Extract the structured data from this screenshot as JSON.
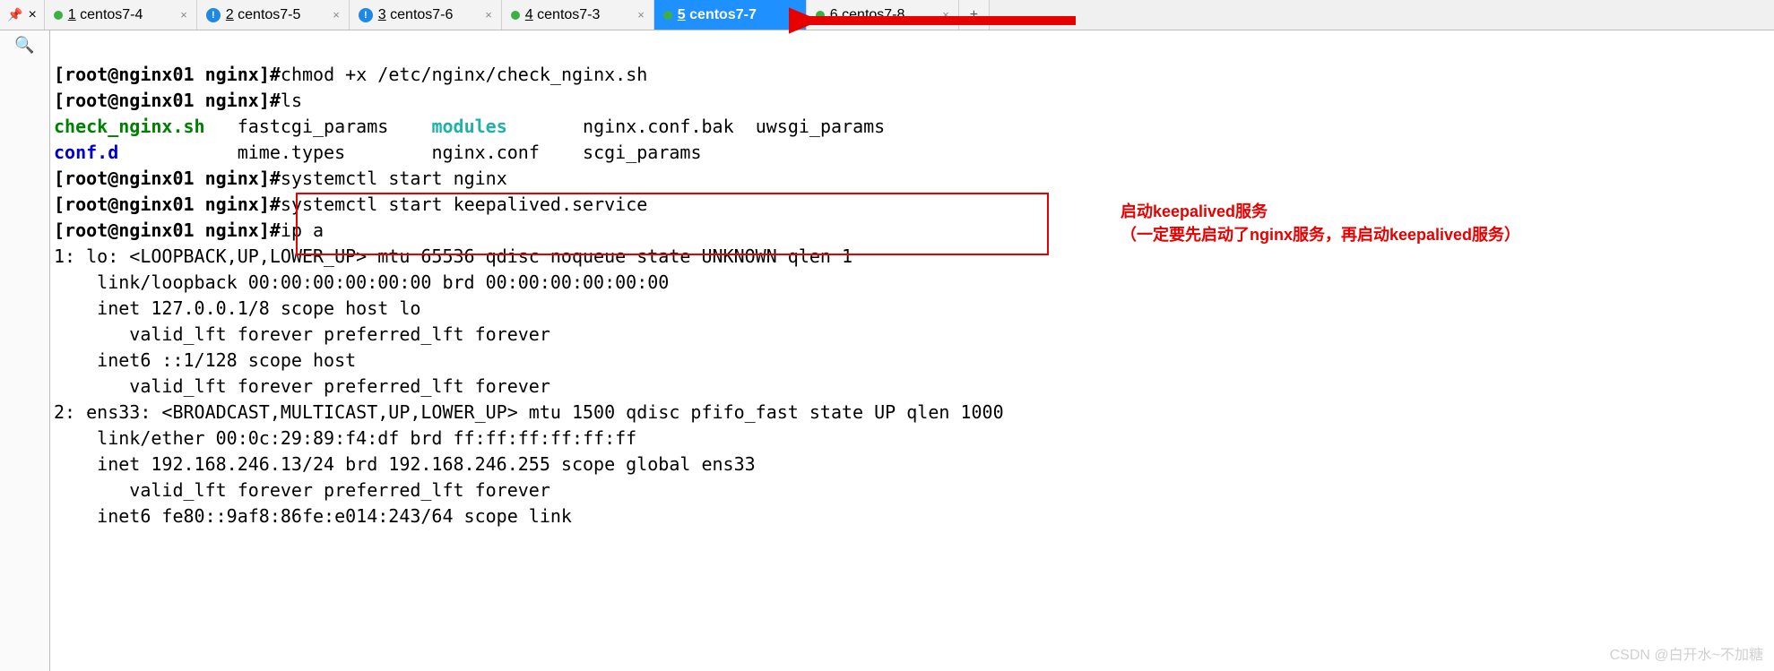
{
  "tabs": [
    {
      "num": "1",
      "label": "centos7-4",
      "status": "green"
    },
    {
      "num": "2",
      "label": "centos7-5",
      "status": "info"
    },
    {
      "num": "3",
      "label": "centos7-6",
      "status": "info"
    },
    {
      "num": "4",
      "label": "centos7-3",
      "status": "green"
    },
    {
      "num": "5",
      "label": "centos7-7",
      "status": "green",
      "active": true
    },
    {
      "num": "6",
      "label": "centos7-8",
      "status": "green"
    }
  ],
  "prompt": {
    "user_host": "root@nginx01",
    "cwd": "nginx",
    "sep_left": "[",
    "sep_right": "]#"
  },
  "cmd": {
    "chmod": "chmod +x /etc/nginx/check_nginx.sh",
    "ls": "ls",
    "start_nginx": "systemctl start nginx",
    "start_keepalived": "systemctl start keepalived.service",
    "ipa": "ip a"
  },
  "ls_row1": {
    "c0": "check_nginx.sh",
    "c1": "fastcgi_params",
    "c2": "modules",
    "c3": "nginx.conf.bak",
    "c4": "uwsgi_params"
  },
  "ls_row2": {
    "c0": "conf.d",
    "c1": "mime.types",
    "c2": "nginx.conf",
    "c3": "scgi_params"
  },
  "ipa_out": {
    "l1": "1: lo: <LOOPBACK,UP,LOWER_UP> mtu 65536 qdisc noqueue state UNKNOWN qlen 1",
    "l2": "    link/loopback 00:00:00:00:00:00 brd 00:00:00:00:00:00",
    "l3": "    inet 127.0.0.1/8 scope host lo",
    "l4": "       valid_lft forever preferred_lft forever",
    "l5": "    inet6 ::1/128 scope host",
    "l6": "       valid_lft forever preferred_lft forever",
    "l7": "2: ens33: <BROADCAST,MULTICAST,UP,LOWER_UP> mtu 1500 qdisc pfifo_fast state UP qlen 1000",
    "l8": "    link/ether 00:0c:29:89:f4:df brd ff:ff:ff:ff:ff:ff",
    "l9": "    inet 192.168.246.13/24 brd 192.168.246.255 scope global ens33",
    "l10": "       valid_lft forever preferred_lft forever",
    "l11": "    inet6 fe80::9af8:86fe:e014:243/64 scope link"
  },
  "annot": {
    "line1": "启动keepalived服务",
    "line2": "（一定要先启动了nginx服务，再启动keepalived服务）"
  },
  "watermark": "CSDN @白开水~不加糖",
  "glyph": {
    "close": "×",
    "plus": "+",
    "pin": "📌",
    "search": "🔍",
    "info": "!"
  }
}
